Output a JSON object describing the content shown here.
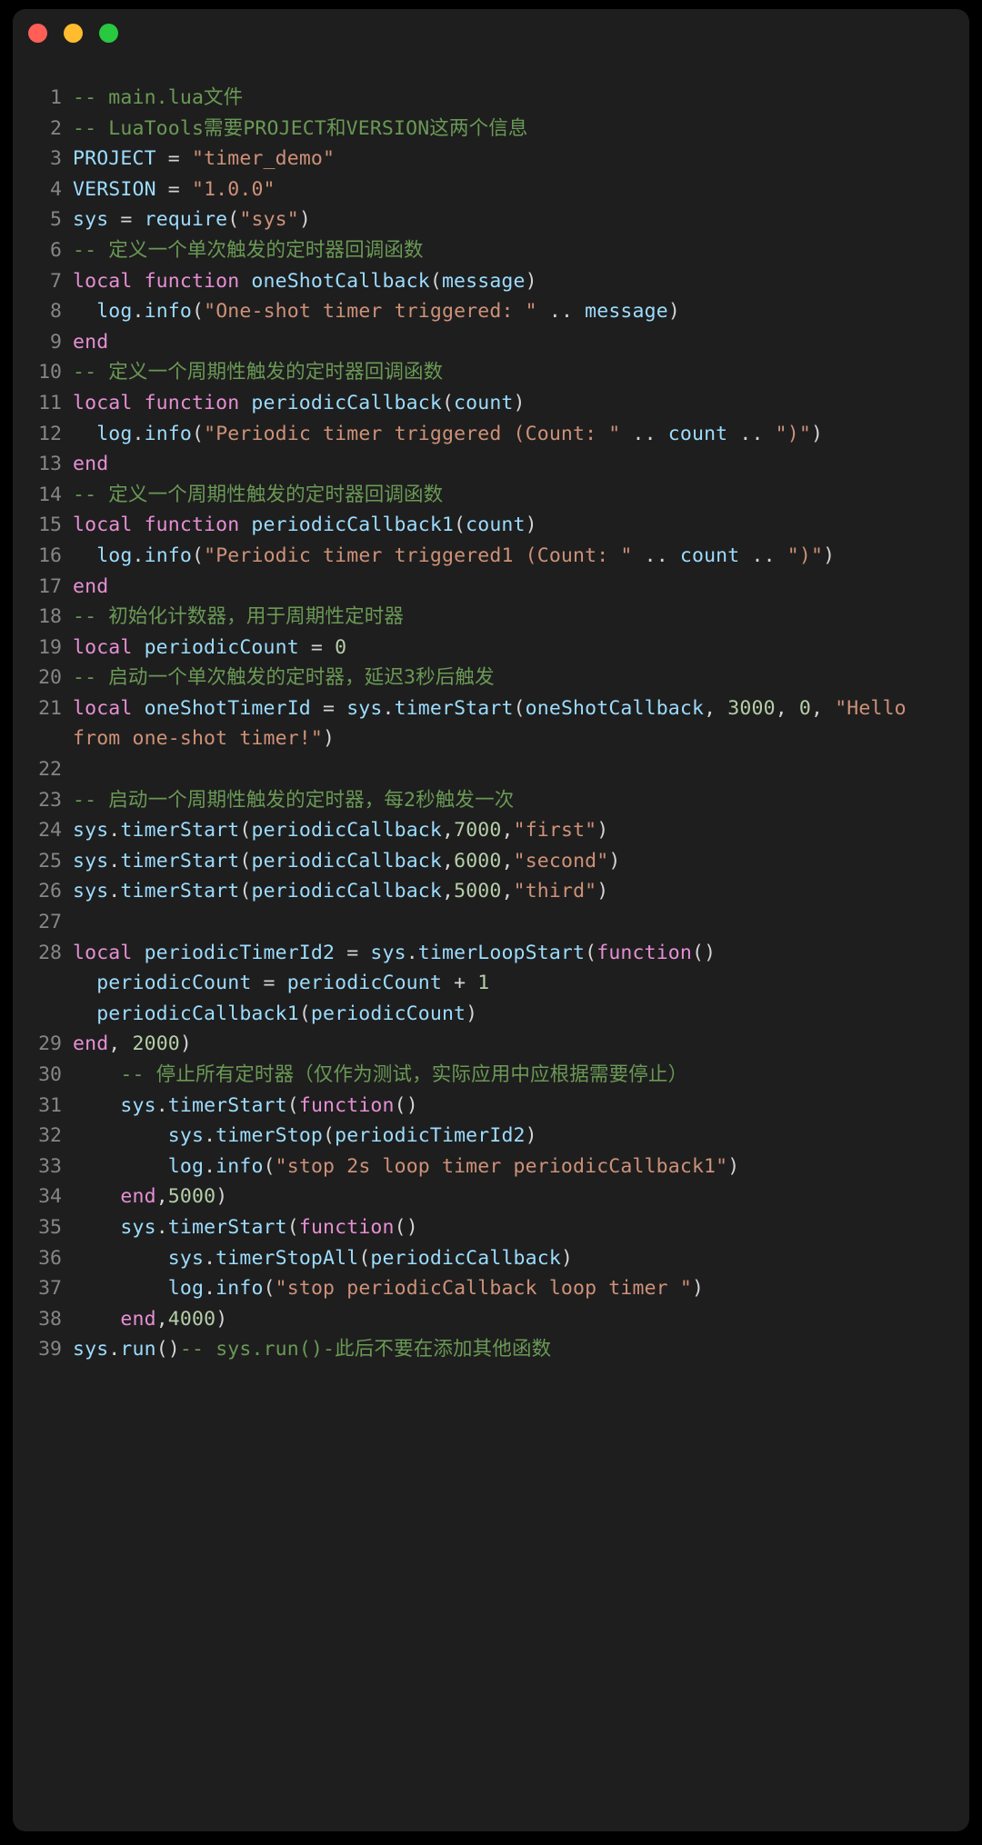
{
  "window": {
    "controls": [
      {
        "name": "close",
        "color": "#FF5F57"
      },
      {
        "name": "minimize",
        "color": "#FEBC2E"
      },
      {
        "name": "maximize",
        "color": "#28C840"
      }
    ],
    "background": "#1E1E1E",
    "page_background": "#000000"
  },
  "editor": {
    "language": "lua",
    "theme_colors": {
      "comment": "#6A9955",
      "keyword": "#E68FD4",
      "identifier": "#9CDCFE",
      "string": "#CE9178",
      "number": "#B5CEA8",
      "plain": "#D4D4D4",
      "line_number": "#868686"
    },
    "lines": [
      {
        "n": "1",
        "tokens": [
          {
            "t": "comment",
            "s": "-- main.lua文件"
          }
        ]
      },
      {
        "n": "2",
        "tokens": [
          {
            "t": "comment",
            "s": "-- LuaTools需要PROJECT和VERSION这两个信息"
          }
        ]
      },
      {
        "n": "3",
        "tokens": [
          {
            "t": "ident",
            "s": "PROJECT"
          },
          {
            "t": "plain",
            "s": " = "
          },
          {
            "t": "string",
            "s": "\"timer_demo\""
          }
        ]
      },
      {
        "n": "4",
        "tokens": [
          {
            "t": "ident",
            "s": "VERSION"
          },
          {
            "t": "plain",
            "s": " = "
          },
          {
            "t": "string",
            "s": "\"1.0.0\""
          }
        ]
      },
      {
        "n": "5",
        "tokens": [
          {
            "t": "ident",
            "s": "sys"
          },
          {
            "t": "plain",
            "s": " = "
          },
          {
            "t": "ident",
            "s": "require"
          },
          {
            "t": "plain",
            "s": "("
          },
          {
            "t": "string",
            "s": "\"sys\""
          },
          {
            "t": "plain",
            "s": ")"
          }
        ]
      },
      {
        "n": "6",
        "tokens": [
          {
            "t": "comment",
            "s": "-- 定义一个单次触发的定时器回调函数"
          }
        ]
      },
      {
        "n": "7",
        "tokens": [
          {
            "t": "keyword",
            "s": "local function "
          },
          {
            "t": "ident",
            "s": "oneShotCallback"
          },
          {
            "t": "plain",
            "s": "("
          },
          {
            "t": "ident",
            "s": "message"
          },
          {
            "t": "plain",
            "s": ")"
          }
        ]
      },
      {
        "n": "8",
        "tokens": [
          {
            "t": "plain",
            "s": "  "
          },
          {
            "t": "ident",
            "s": "log"
          },
          {
            "t": "plain",
            "s": "."
          },
          {
            "t": "ident",
            "s": "info"
          },
          {
            "t": "plain",
            "s": "("
          },
          {
            "t": "string",
            "s": "\"One-shot timer triggered: \""
          },
          {
            "t": "plain",
            "s": " .. "
          },
          {
            "t": "ident",
            "s": "message"
          },
          {
            "t": "plain",
            "s": ")"
          }
        ]
      },
      {
        "n": "9",
        "tokens": [
          {
            "t": "keyword",
            "s": "end"
          }
        ]
      },
      {
        "n": "10",
        "tokens": [
          {
            "t": "comment",
            "s": "-- 定义一个周期性触发的定时器回调函数"
          }
        ]
      },
      {
        "n": "11",
        "tokens": [
          {
            "t": "keyword",
            "s": "local function "
          },
          {
            "t": "ident",
            "s": "periodicCallback"
          },
          {
            "t": "plain",
            "s": "("
          },
          {
            "t": "ident",
            "s": "count"
          },
          {
            "t": "plain",
            "s": ")"
          }
        ]
      },
      {
        "n": "12",
        "tokens": [
          {
            "t": "plain",
            "s": "  "
          },
          {
            "t": "ident",
            "s": "log"
          },
          {
            "t": "plain",
            "s": "."
          },
          {
            "t": "ident",
            "s": "info"
          },
          {
            "t": "plain",
            "s": "("
          },
          {
            "t": "string",
            "s": "\"Periodic timer triggered (Count: \""
          },
          {
            "t": "plain",
            "s": " .. "
          },
          {
            "t": "ident",
            "s": "count"
          },
          {
            "t": "plain",
            "s": " .. "
          },
          {
            "t": "string",
            "s": "\")\""
          },
          {
            "t": "plain",
            "s": ")"
          }
        ]
      },
      {
        "n": "13",
        "tokens": [
          {
            "t": "keyword",
            "s": "end"
          }
        ]
      },
      {
        "n": "14",
        "tokens": [
          {
            "t": "comment",
            "s": "-- 定义一个周期性触发的定时器回调函数"
          }
        ]
      },
      {
        "n": "15",
        "tokens": [
          {
            "t": "keyword",
            "s": "local function "
          },
          {
            "t": "ident",
            "s": "periodicCallback1"
          },
          {
            "t": "plain",
            "s": "("
          },
          {
            "t": "ident",
            "s": "count"
          },
          {
            "t": "plain",
            "s": ")"
          }
        ]
      },
      {
        "n": "16",
        "tokens": [
          {
            "t": "plain",
            "s": "  "
          },
          {
            "t": "ident",
            "s": "log"
          },
          {
            "t": "plain",
            "s": "."
          },
          {
            "t": "ident",
            "s": "info"
          },
          {
            "t": "plain",
            "s": "("
          },
          {
            "t": "string",
            "s": "\"Periodic timer triggered1 (Count: \""
          },
          {
            "t": "plain",
            "s": " .. "
          },
          {
            "t": "ident",
            "s": "count"
          },
          {
            "t": "plain",
            "s": " .. "
          },
          {
            "t": "string",
            "s": "\")\""
          },
          {
            "t": "plain",
            "s": ")"
          }
        ]
      },
      {
        "n": "17",
        "tokens": [
          {
            "t": "keyword",
            "s": "end"
          }
        ]
      },
      {
        "n": "18",
        "tokens": [
          {
            "t": "comment",
            "s": "-- 初始化计数器，用于周期性定时器"
          }
        ]
      },
      {
        "n": "19",
        "tokens": [
          {
            "t": "keyword",
            "s": "local "
          },
          {
            "t": "ident",
            "s": "periodicCount"
          },
          {
            "t": "plain",
            "s": " = "
          },
          {
            "t": "number",
            "s": "0"
          }
        ]
      },
      {
        "n": "20",
        "tokens": [
          {
            "t": "comment",
            "s": "-- 启动一个单次触发的定时器，延迟3秒后触发"
          }
        ]
      },
      {
        "n": "21",
        "tokens": [
          {
            "t": "keyword",
            "s": "local "
          },
          {
            "t": "ident",
            "s": "oneShotTimerId"
          },
          {
            "t": "plain",
            "s": " = "
          },
          {
            "t": "ident",
            "s": "sys"
          },
          {
            "t": "plain",
            "s": "."
          },
          {
            "t": "ident",
            "s": "timerStart"
          },
          {
            "t": "plain",
            "s": "("
          },
          {
            "t": "ident",
            "s": "oneShotCallback"
          },
          {
            "t": "plain",
            "s": ", "
          },
          {
            "t": "number",
            "s": "3000"
          },
          {
            "t": "plain",
            "s": ", "
          },
          {
            "t": "number",
            "s": "0"
          },
          {
            "t": "plain",
            "s": ", "
          },
          {
            "t": "string",
            "s": "\"Hello from one-shot timer!\""
          },
          {
            "t": "plain",
            "s": ")"
          }
        ]
      },
      {
        "n": "22",
        "tokens": []
      },
      {
        "n": "23",
        "tokens": [
          {
            "t": "comment",
            "s": "-- 启动一个周期性触发的定时器，每2秒触发一次"
          }
        ]
      },
      {
        "n": "24",
        "tokens": [
          {
            "t": "ident",
            "s": "sys"
          },
          {
            "t": "plain",
            "s": "."
          },
          {
            "t": "ident",
            "s": "timerStart"
          },
          {
            "t": "plain",
            "s": "("
          },
          {
            "t": "ident",
            "s": "periodicCallback"
          },
          {
            "t": "plain",
            "s": ","
          },
          {
            "t": "number",
            "s": "7000"
          },
          {
            "t": "plain",
            "s": ","
          },
          {
            "t": "string",
            "s": "\"first\""
          },
          {
            "t": "plain",
            "s": ")"
          }
        ]
      },
      {
        "n": "25",
        "tokens": [
          {
            "t": "ident",
            "s": "sys"
          },
          {
            "t": "plain",
            "s": "."
          },
          {
            "t": "ident",
            "s": "timerStart"
          },
          {
            "t": "plain",
            "s": "("
          },
          {
            "t": "ident",
            "s": "periodicCallback"
          },
          {
            "t": "plain",
            "s": ","
          },
          {
            "t": "number",
            "s": "6000"
          },
          {
            "t": "plain",
            "s": ","
          },
          {
            "t": "string",
            "s": "\"second\""
          },
          {
            "t": "plain",
            "s": ")"
          }
        ]
      },
      {
        "n": "26",
        "tokens": [
          {
            "t": "ident",
            "s": "sys"
          },
          {
            "t": "plain",
            "s": "."
          },
          {
            "t": "ident",
            "s": "timerStart"
          },
          {
            "t": "plain",
            "s": "("
          },
          {
            "t": "ident",
            "s": "periodicCallback"
          },
          {
            "t": "plain",
            "s": ","
          },
          {
            "t": "number",
            "s": "5000"
          },
          {
            "t": "plain",
            "s": ","
          },
          {
            "t": "string",
            "s": "\"third\""
          },
          {
            "t": "plain",
            "s": ")"
          }
        ]
      },
      {
        "n": "27",
        "tokens": []
      },
      {
        "n": "28",
        "tokens": [
          {
            "t": "keyword",
            "s": "local "
          },
          {
            "t": "ident",
            "s": "periodicTimerId2"
          },
          {
            "t": "plain",
            "s": " = "
          },
          {
            "t": "ident",
            "s": "sys"
          },
          {
            "t": "plain",
            "s": "."
          },
          {
            "t": "ident",
            "s": "timerLoopStart"
          },
          {
            "t": "plain",
            "s": "("
          },
          {
            "t": "keyword",
            "s": "function"
          },
          {
            "t": "plain",
            "s": "()\n  "
          },
          {
            "t": "ident",
            "s": "periodicCount"
          },
          {
            "t": "plain",
            "s": " = "
          },
          {
            "t": "ident",
            "s": "periodicCount"
          },
          {
            "t": "plain",
            "s": " + "
          },
          {
            "t": "number",
            "s": "1"
          },
          {
            "t": "plain",
            "s": "\n  "
          },
          {
            "t": "ident",
            "s": "periodicCallback1"
          },
          {
            "t": "plain",
            "s": "("
          },
          {
            "t": "ident",
            "s": "periodicCount"
          },
          {
            "t": "plain",
            "s": ")"
          }
        ]
      },
      {
        "n": "29",
        "tokens": [
          {
            "t": "keyword",
            "s": "end"
          },
          {
            "t": "plain",
            "s": ", "
          },
          {
            "t": "number",
            "s": "2000"
          },
          {
            "t": "plain",
            "s": ")"
          }
        ]
      },
      {
        "n": "30",
        "tokens": [
          {
            "t": "plain",
            "s": "    "
          },
          {
            "t": "comment",
            "s": "-- 停止所有定时器（仅作为测试，实际应用中应根据需要停止）"
          }
        ]
      },
      {
        "n": "31",
        "tokens": [
          {
            "t": "plain",
            "s": "    "
          },
          {
            "t": "ident",
            "s": "sys"
          },
          {
            "t": "plain",
            "s": "."
          },
          {
            "t": "ident",
            "s": "timerStart"
          },
          {
            "t": "plain",
            "s": "("
          },
          {
            "t": "keyword",
            "s": "function"
          },
          {
            "t": "plain",
            "s": "()"
          }
        ]
      },
      {
        "n": "32",
        "tokens": [
          {
            "t": "plain",
            "s": "        "
          },
          {
            "t": "ident",
            "s": "sys"
          },
          {
            "t": "plain",
            "s": "."
          },
          {
            "t": "ident",
            "s": "timerStop"
          },
          {
            "t": "plain",
            "s": "("
          },
          {
            "t": "ident",
            "s": "periodicTimerId2"
          },
          {
            "t": "plain",
            "s": ")"
          }
        ]
      },
      {
        "n": "33",
        "tokens": [
          {
            "t": "plain",
            "s": "        "
          },
          {
            "t": "ident",
            "s": "log"
          },
          {
            "t": "plain",
            "s": "."
          },
          {
            "t": "ident",
            "s": "info"
          },
          {
            "t": "plain",
            "s": "("
          },
          {
            "t": "string",
            "s": "\"stop 2s loop timer periodicCallback1\""
          },
          {
            "t": "plain",
            "s": ")"
          }
        ]
      },
      {
        "n": "34",
        "tokens": [
          {
            "t": "plain",
            "s": "    "
          },
          {
            "t": "keyword",
            "s": "end"
          },
          {
            "t": "plain",
            "s": ","
          },
          {
            "t": "number",
            "s": "5000"
          },
          {
            "t": "plain",
            "s": ")"
          }
        ]
      },
      {
        "n": "35",
        "tokens": [
          {
            "t": "plain",
            "s": "    "
          },
          {
            "t": "ident",
            "s": "sys"
          },
          {
            "t": "plain",
            "s": "."
          },
          {
            "t": "ident",
            "s": "timerStart"
          },
          {
            "t": "plain",
            "s": "("
          },
          {
            "t": "keyword",
            "s": "function"
          },
          {
            "t": "plain",
            "s": "()"
          }
        ]
      },
      {
        "n": "36",
        "tokens": [
          {
            "t": "plain",
            "s": "        "
          },
          {
            "t": "ident",
            "s": "sys"
          },
          {
            "t": "plain",
            "s": "."
          },
          {
            "t": "ident",
            "s": "timerStopAll"
          },
          {
            "t": "plain",
            "s": "("
          },
          {
            "t": "ident",
            "s": "periodicCallback"
          },
          {
            "t": "plain",
            "s": ")"
          }
        ]
      },
      {
        "n": "37",
        "tokens": [
          {
            "t": "plain",
            "s": "        "
          },
          {
            "t": "ident",
            "s": "log"
          },
          {
            "t": "plain",
            "s": "."
          },
          {
            "t": "ident",
            "s": "info"
          },
          {
            "t": "plain",
            "s": "("
          },
          {
            "t": "string",
            "s": "\"stop periodicCallback loop timer \""
          },
          {
            "t": "plain",
            "s": ")"
          }
        ]
      },
      {
        "n": "38",
        "tokens": [
          {
            "t": "plain",
            "s": "    "
          },
          {
            "t": "keyword",
            "s": "end"
          },
          {
            "t": "plain",
            "s": ","
          },
          {
            "t": "number",
            "s": "4000"
          },
          {
            "t": "plain",
            "s": ")"
          }
        ]
      },
      {
        "n": "39",
        "tokens": [
          {
            "t": "ident",
            "s": "sys"
          },
          {
            "t": "plain",
            "s": "."
          },
          {
            "t": "ident",
            "s": "run"
          },
          {
            "t": "plain",
            "s": "()"
          },
          {
            "t": "comment",
            "s": "-- sys.run()-此后不要在添加其他函数"
          }
        ]
      }
    ]
  }
}
